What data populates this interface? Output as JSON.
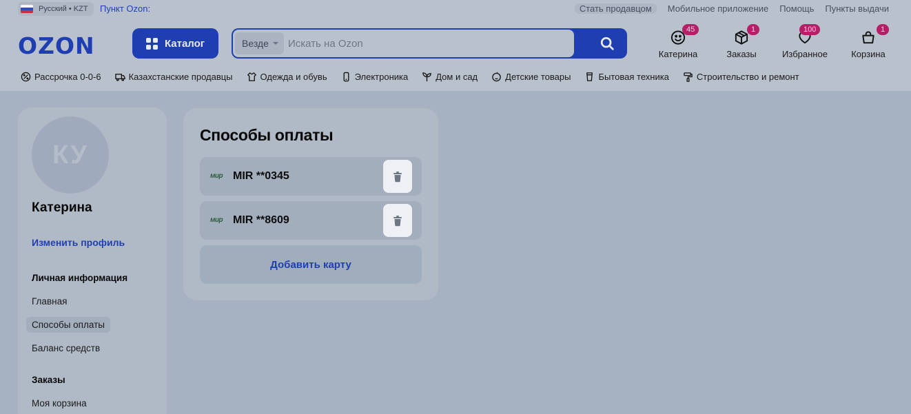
{
  "topbar": {
    "language": "Русский • KZT",
    "pickup_point": "Пункт Ozon:",
    "links": [
      "Стать продавцом",
      "Мобильное приложение",
      "Помощь",
      "Пункты выдачи"
    ]
  },
  "header": {
    "logo": "OZON",
    "catalog_label": "Каталог",
    "search": {
      "scope": "Везде",
      "placeholder": "Искать на Ozon"
    },
    "icons": [
      {
        "label": "Катерина",
        "badge": "45",
        "icon": "smile-icon"
      },
      {
        "label": "Заказы",
        "badge": "1",
        "icon": "box-icon"
      },
      {
        "label": "Избранное",
        "badge": "100",
        "icon": "heart-icon"
      },
      {
        "label": "Корзина",
        "badge": "1",
        "icon": "bag-icon"
      }
    ]
  },
  "categories": [
    {
      "label": "Рассрочка 0-0-6",
      "icon": "percent-icon"
    },
    {
      "label": "Казахстанские продавцы",
      "icon": "truck-icon"
    },
    {
      "label": "Одежда и обувь",
      "icon": "clothes-icon"
    },
    {
      "label": "Электроника",
      "icon": "phone-icon"
    },
    {
      "label": "Дом и сад",
      "icon": "plant-icon"
    },
    {
      "label": "Детские товары",
      "icon": "baby-icon"
    },
    {
      "label": "Бытовая техника",
      "icon": "appliance-icon"
    },
    {
      "label": "Строительство и ремонт",
      "icon": "roller-icon"
    }
  ],
  "sidebar": {
    "avatar_initials": "КУ",
    "user_name": "Катерина",
    "edit_profile": "Изменить профиль",
    "section_personal": "Личная информация",
    "items_personal": [
      "Главная",
      "Способы оплаты",
      "Баланс средств"
    ],
    "active_item": "Способы оплаты",
    "section_orders": "Заказы",
    "items_orders": [
      "Моя корзина"
    ]
  },
  "payment": {
    "title": "Способы оплаты",
    "cards": [
      {
        "brand": "мир",
        "label": "MIR **0345"
      },
      {
        "brand": "мир",
        "label": "MIR **8609"
      }
    ],
    "add_card": "Добавить карту"
  },
  "colors": {
    "accent": "#1f3fb0",
    "badge": "#b51f67",
    "overlay_bg": "#a6b2c1"
  }
}
